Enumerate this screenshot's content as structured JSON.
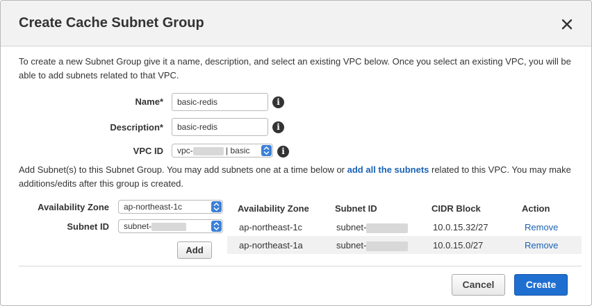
{
  "dialog": {
    "title": "Create Cache Subnet Group",
    "intro": "To create a new Subnet Group give it a name, description, and select an existing VPC below. Once you select an existing VPC, you will be able to add subnets related to that VPC."
  },
  "form": {
    "name_label": "Name*",
    "name_value": "basic-redis",
    "description_label": "Description*",
    "description_value": "basic-redis",
    "vpc_label": "VPC ID",
    "vpc_prefix": "vpc-",
    "vpc_suffix": "| basic",
    "info_glyph": "i"
  },
  "subnets": {
    "add_text_before": "Add Subnet(s) to this Subnet Group. You may add subnets one at a time below or ",
    "add_all_link": "add all the subnets",
    "add_text_after": " related to this VPC. You may make additions/edits after this group is created.",
    "az_label": "Availability Zone",
    "az_value": "ap-northeast-1c",
    "subnet_label": "Subnet ID",
    "subnet_prefix": "subnet-",
    "add_button": "Add"
  },
  "table": {
    "headers": [
      "Availability Zone",
      "Subnet ID",
      "CIDR Block",
      "Action"
    ],
    "rows": [
      {
        "az": "ap-northeast-1c",
        "subnet": "subnet-",
        "cidr": "10.0.15.32/27",
        "action": "Remove"
      },
      {
        "az": "ap-northeast-1a",
        "subnet": "subnet-",
        "cidr": "10.0.15.0/27",
        "action": "Remove"
      }
    ]
  },
  "footer": {
    "cancel": "Cancel",
    "create": "Create"
  },
  "colors": {
    "link": "#1a63b4",
    "primary_button": "#1f6fd1",
    "stepper": "#3b80d9"
  },
  "icons": {
    "close": "close-icon",
    "info": "info-icon",
    "stepper": "select-stepper-icon"
  }
}
